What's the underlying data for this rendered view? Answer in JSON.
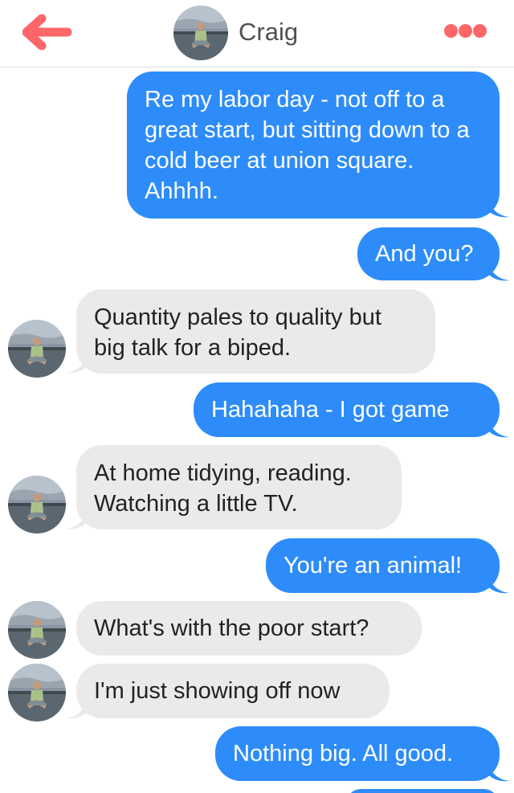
{
  "header": {
    "contact_name": "Craig",
    "back_icon": "back-arrow-icon",
    "more_icon": "more-options-icon",
    "accent_color": "#fe6668"
  },
  "colors": {
    "outgoing_bubble": "#2d8cfa",
    "incoming_bubble": "#eaeaea"
  },
  "messages": [
    {
      "direction": "out",
      "text": "Re my labor day - not off to a great start, but sitting down to a cold beer at union square. Ahhhh."
    },
    {
      "direction": "out",
      "text": "And you?"
    },
    {
      "direction": "in",
      "text": "Quantity pales to quality but big talk for a biped."
    },
    {
      "direction": "out",
      "text": "Hahahaha - I got game"
    },
    {
      "direction": "in",
      "text": "At home tidying, reading. Watching a little TV."
    },
    {
      "direction": "out",
      "text": "You're an animal!"
    },
    {
      "direction": "in",
      "text": "What's with the poor start?"
    },
    {
      "direction": "in",
      "text": "I'm just showing off now"
    },
    {
      "direction": "out",
      "text": "Nothing big. All good."
    }
  ]
}
